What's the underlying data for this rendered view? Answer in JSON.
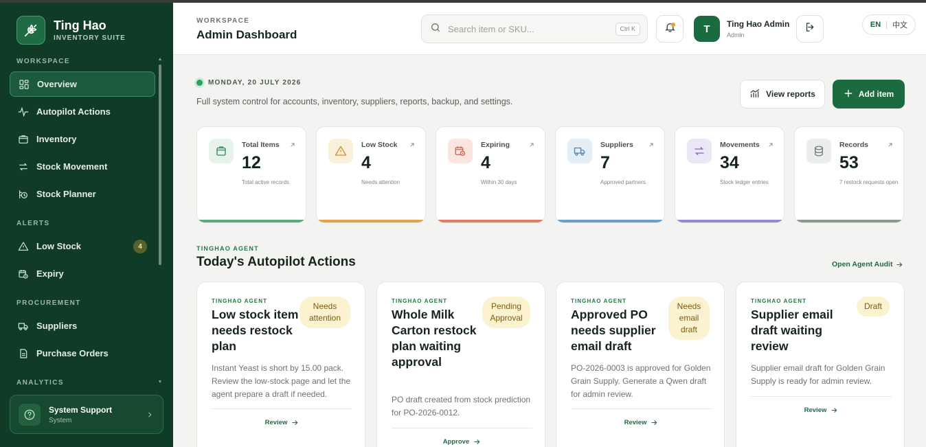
{
  "brand": {
    "name": "Ting Hao",
    "subtitle": "INVENTORY SUITE"
  },
  "sidebar": {
    "sections": [
      {
        "label": "WORKSPACE",
        "items": [
          {
            "label": "Overview",
            "icon": "grid-icon",
            "active": true
          },
          {
            "label": "Autopilot Actions",
            "icon": "pulse-icon"
          },
          {
            "label": "Inventory",
            "icon": "box-icon"
          },
          {
            "label": "Stock Movement",
            "icon": "swap-icon"
          },
          {
            "label": "Stock Planner",
            "icon": "planner-icon"
          }
        ]
      },
      {
        "label": "ALERTS",
        "items": [
          {
            "label": "Low Stock",
            "icon": "warning-icon",
            "badge": "4"
          },
          {
            "label": "Expiry",
            "icon": "calendar-clock-icon"
          }
        ]
      },
      {
        "label": "PROCUREMENT",
        "items": [
          {
            "label": "Suppliers",
            "icon": "truck-icon"
          },
          {
            "label": "Purchase Orders",
            "icon": "document-icon"
          }
        ]
      },
      {
        "label": "ANALYTICS",
        "items": []
      }
    ],
    "support": {
      "title": "System Support",
      "subtitle": "System"
    }
  },
  "header": {
    "eyebrow": "WORKSPACE",
    "title": "Admin Dashboard",
    "search_placeholder": "Search item or SKU...",
    "search_shortcut": "Ctrl K",
    "user": {
      "initial": "T",
      "name": "Ting Hao Admin",
      "role": "Admin"
    },
    "lang": {
      "active": "EN",
      "other": "中文"
    }
  },
  "main": {
    "date": "MONDAY, 20 JULY 2026",
    "description": "Full system control for accounts, inventory, suppliers, reports, backup, and settings.",
    "view_reports": "View reports",
    "add_item": "Add item",
    "stats": [
      {
        "label": "Total Items",
        "value": "12",
        "note": "Total active records",
        "color": "#5fa77c",
        "bg": "#e6f2ea",
        "icon": "box-icon"
      },
      {
        "label": "Low Stock",
        "value": "4",
        "note": "Needs attention",
        "color": "#e1a24a",
        "bg": "#fbf0dc",
        "icon": "warning-icon"
      },
      {
        "label": "Expiring",
        "value": "4",
        "note": "Within 30 days",
        "color": "#e27b66",
        "bg": "#fbe5e0",
        "icon": "calendar-clock-icon"
      },
      {
        "label": "Suppliers",
        "value": "7",
        "note": "Approved partners",
        "color": "#6a9fc4",
        "bg": "#e3eef6",
        "icon": "truck-icon"
      },
      {
        "label": "Movements",
        "value": "34",
        "note": "Stock ledger entries",
        "color": "#9a85d1",
        "bg": "#ece7f7",
        "icon": "swap-icon"
      },
      {
        "label": "Records",
        "value": "53",
        "note": "7 restock requests open",
        "color": "#8e9690",
        "bg": "#eceeec",
        "icon": "database-icon"
      }
    ],
    "agent_eyebrow": "TINGHAO AGENT",
    "agent_title": "Today's Autopilot Actions",
    "audit_link": "Open Agent Audit",
    "cards": [
      {
        "eyebrow": "TINGHAO AGENT",
        "title": "Low stock item needs restock plan",
        "badge": "Needs attention",
        "body": "Instant Yeast is short by 15.00 pack. Review the low-stock page and let the agent prepare a draft if needed.",
        "action": "Review"
      },
      {
        "eyebrow": "TINGHAO AGENT",
        "title": "Whole Milk Carton restock plan waiting approval",
        "badge": "Pending Approval",
        "body": "PO draft created from stock prediction for PO-2026-0012.",
        "action": "Approve"
      },
      {
        "eyebrow": "TINGHAO AGENT",
        "title": "Approved PO needs supplier email draft",
        "badge": "Needs email draft",
        "body": "PO-2026-0003 is approved for Golden Grain Supply. Generate a Qwen draft for admin review.",
        "action": "Review"
      },
      {
        "eyebrow": "TINGHAO AGENT",
        "title": "Supplier email draft waiting review",
        "badge": "Draft",
        "body": "Supplier email draft for Golden Grain Supply is ready for admin review.",
        "action": "Review"
      }
    ]
  }
}
